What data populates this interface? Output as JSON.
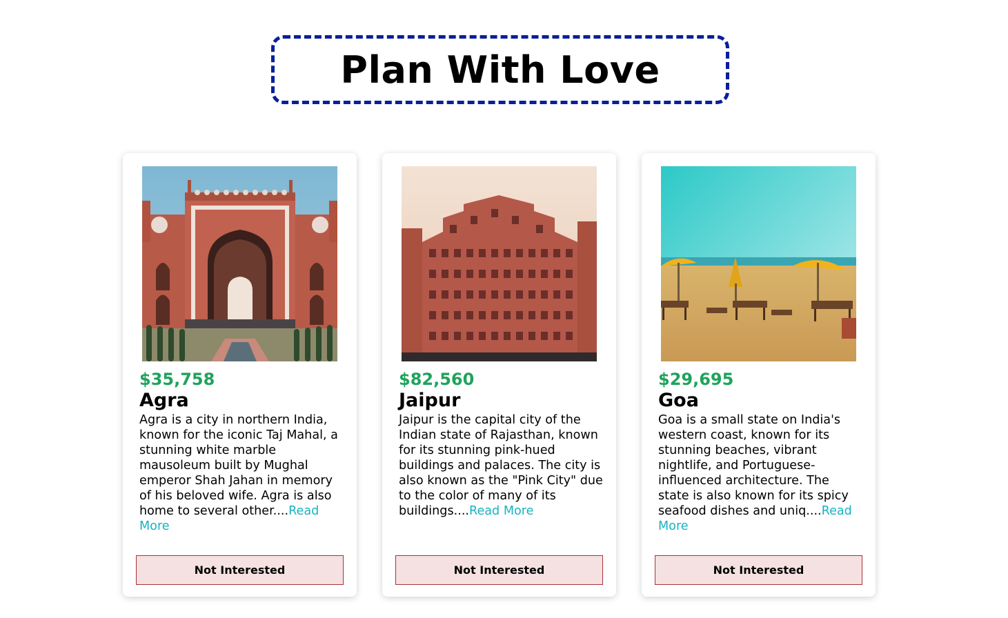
{
  "header": {
    "title": "Plan With Love"
  },
  "tours": [
    {
      "price": "$35,758",
      "name": "Agra",
      "description": "Agra is a city in northern India, known for the iconic Taj Mahal, a stunning white marble mausoleum built by Mughal emperor Shah Jahan in memory of his beloved wife. Agra is also home to several other....",
      "read_more": "Read More",
      "button": "Not Interested",
      "image": "red sandstone gateway with arch and gardens"
    },
    {
      "price": "$82,560",
      "name": "Jaipur",
      "description": "Jaipur is the capital city of the Indian state of Rajasthan, known for its stunning pink-hued buildings and palaces. The city is also known as the \"Pink City\" due to the color of many of its buildings....",
      "read_more": "Read More",
      "button": "Not Interested",
      "image": "pink palace facade with many windows"
    },
    {
      "price": "$29,695",
      "name": "Goa",
      "description": "Goa is a small state on India's western coast, known for its stunning beaches, vibrant nightlife, and Portuguese-influenced architecture. The state is also known for its spicy seafood dishes and uniq....",
      "read_more": "Read More",
      "button": "Not Interested",
      "image": "sandy beach with yellow umbrellas and loungers"
    }
  ],
  "colors": {
    "title_border": "#0a1f9a",
    "price": "#1fa35c",
    "read_more": "#17b3c1",
    "button_bg": "#f5e1e2",
    "button_border": "#a83236"
  }
}
